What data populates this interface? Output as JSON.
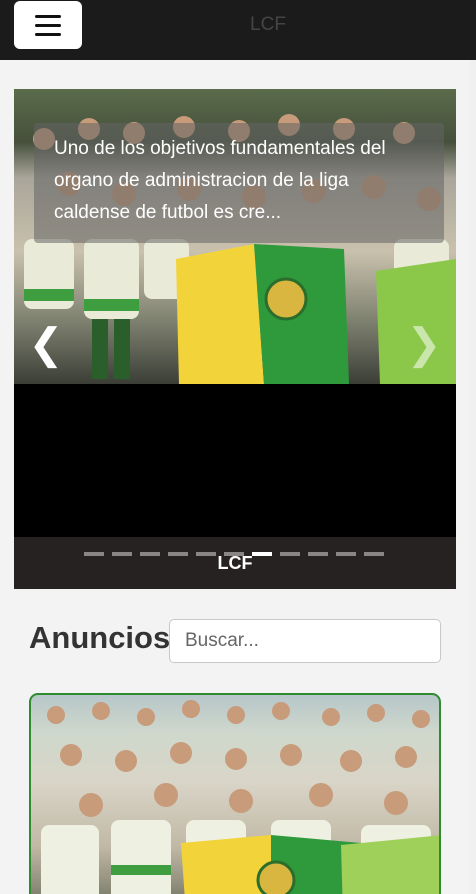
{
  "header": {
    "brand": "LCF"
  },
  "carousel": {
    "caption": "Uno de los objetivos fundamentales del organo de administracion de la liga caldense de futbol es cre...",
    "label": "LCF",
    "indicator_count": 11,
    "active_index": 6
  },
  "announcements": {
    "title": "Anuncios",
    "search_placeholder": "Buscar..."
  },
  "colors": {
    "topbar": "#1b1b1b",
    "flag_yellow": "#f2d43a",
    "flag_green": "#2e9a3c",
    "card_border": "#2e8b2e"
  }
}
